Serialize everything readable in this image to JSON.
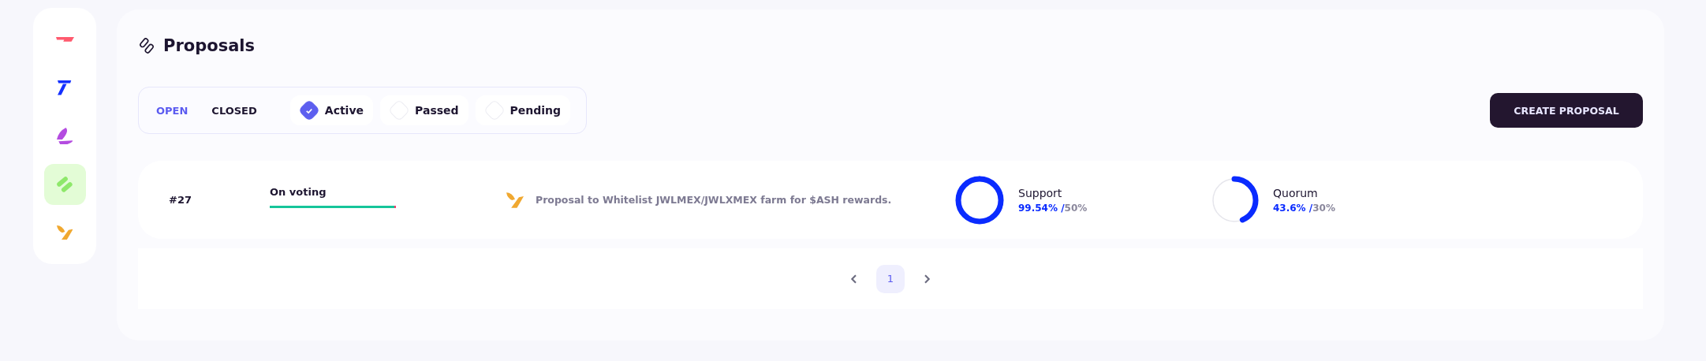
{
  "sidebar": {
    "items": [
      {
        "kind": "dash",
        "color": "#ff5a6e",
        "selected": false
      },
      {
        "kind": "hook",
        "color": "#1430ff",
        "selected": false
      },
      {
        "kind": "leaves",
        "color": "#b44ce0",
        "selected": false
      },
      {
        "kind": "pills",
        "color": "#8ee86a",
        "selected": true
      },
      {
        "kind": "fork",
        "color": "#f0a830",
        "selected": false
      }
    ]
  },
  "page": {
    "title": "Proposals"
  },
  "tabs": [
    {
      "label": "OPEN",
      "selected": true
    },
    {
      "label": "CLOSED",
      "selected": false
    }
  ],
  "filters": [
    {
      "label": "Active",
      "checked": true
    },
    {
      "label": "Passed",
      "checked": false
    },
    {
      "label": "Pending",
      "checked": false
    }
  ],
  "create_button": "CREATE PROPOSAL",
  "proposals": [
    {
      "number": "#27",
      "status": "On voting",
      "level": 0.99,
      "title": "Proposal to Whitelist JWLMEX/JWLXMEX farm for $ASH rewards.",
      "metrics": [
        {
          "label": "Support",
          "value": "99.54%",
          "separator": "/",
          "threshold": "50%",
          "level": 0.9954
        },
        {
          "label": "Quorum",
          "value": "43.6%",
          "separator": "/",
          "threshold": "30%",
          "level": 0.436
        }
      ]
    }
  ],
  "pagination": {
    "pages": [
      {
        "label": "1",
        "selected": true
      }
    ]
  }
}
